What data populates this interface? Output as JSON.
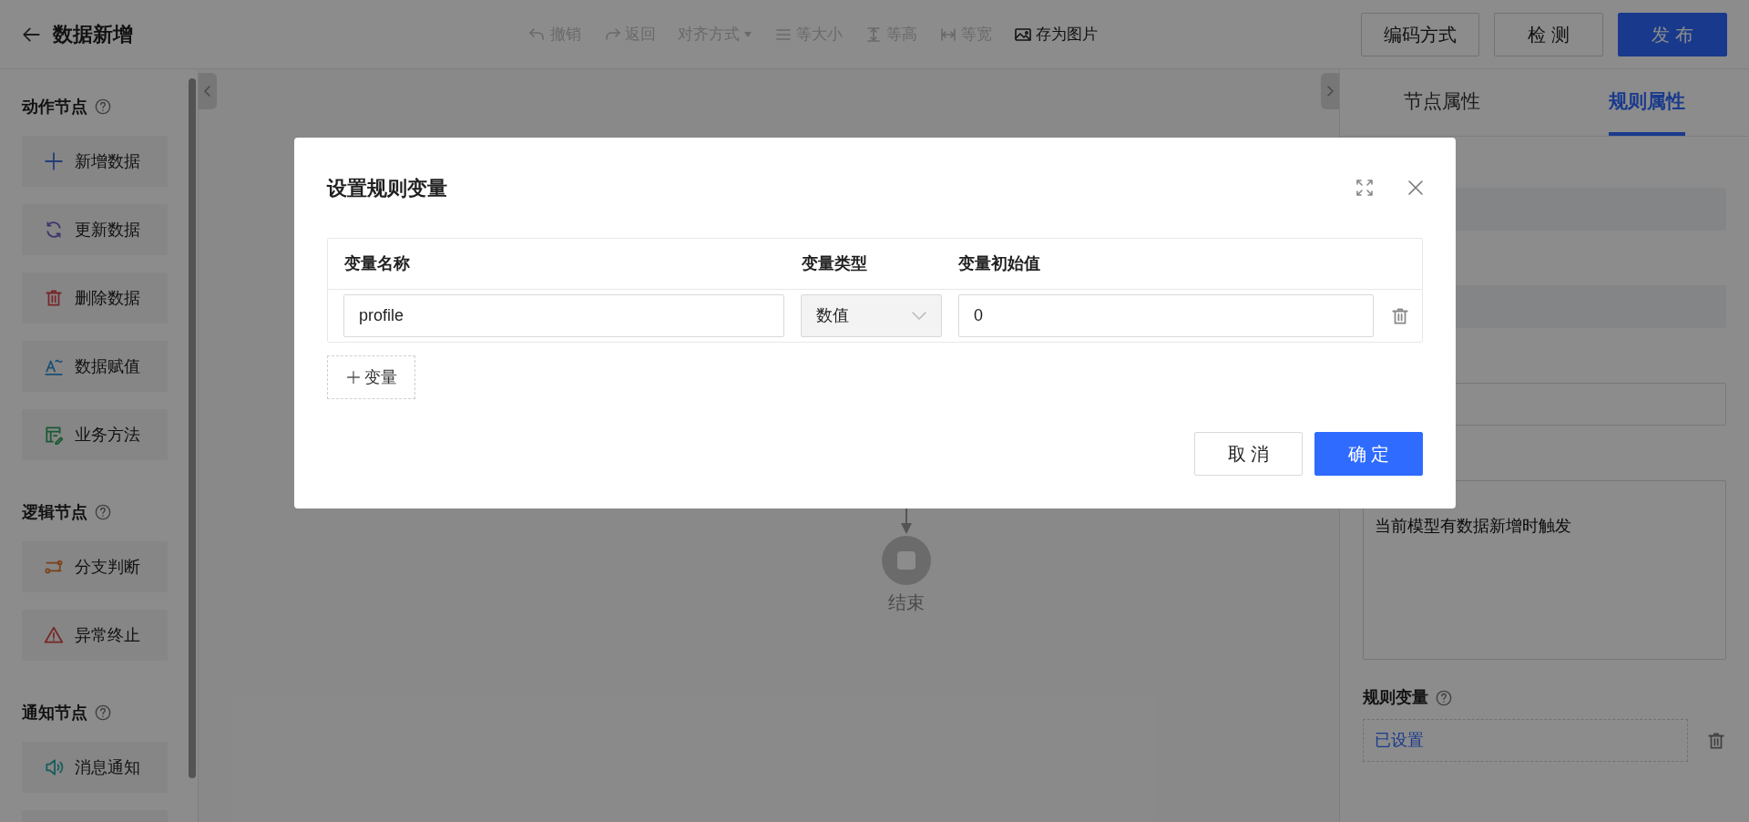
{
  "header": {
    "title": "数据新增",
    "toolbar": [
      {
        "label": "撤销",
        "kind": "undo",
        "disabled": true
      },
      {
        "label": "返回",
        "kind": "redo",
        "disabled": true
      },
      {
        "label": "对齐方式",
        "kind": "dropdown",
        "disabled": true
      },
      {
        "label": "等大小",
        "kind": "size",
        "disabled": true
      },
      {
        "label": "等高",
        "kind": "height",
        "disabled": true
      },
      {
        "label": "等宽",
        "kind": "width",
        "disabled": true
      },
      {
        "label": "存为图片",
        "kind": "image",
        "disabled": false
      }
    ],
    "actions": [
      {
        "label": "编码方式",
        "kind": "default"
      },
      {
        "label": "检 测",
        "kind": "default"
      },
      {
        "label": "发 布",
        "kind": "primary"
      }
    ]
  },
  "sidebar": {
    "sections": [
      {
        "title": "动作节点",
        "items": [
          {
            "label": "新增数据",
            "kind": "plus"
          },
          {
            "label": "更新数据",
            "kind": "refresh"
          },
          {
            "label": "删除数据",
            "kind": "trash"
          },
          {
            "label": "数据赋值",
            "kind": "assign"
          },
          {
            "label": "业务方法",
            "kind": "method"
          }
        ]
      },
      {
        "title": "逻辑节点",
        "items": [
          {
            "label": "分支判断",
            "kind": "branch"
          },
          {
            "label": "异常终止",
            "kind": "warning"
          }
        ]
      },
      {
        "title": "通知节点",
        "items": [
          {
            "label": "消息通知",
            "kind": "message"
          }
        ]
      }
    ]
  },
  "canvas": {
    "end_node": "结束"
  },
  "properties": {
    "tabs": [
      {
        "label": "节点属性",
        "selected": false
      },
      {
        "label": "规则属性",
        "selected": true
      }
    ],
    "description": "当前模型有数据新增时触发",
    "rule_variables": {
      "label": "规则变量",
      "value": "已设置"
    }
  },
  "dialog": {
    "title": "设置规则变量",
    "columns": [
      "变量名称",
      "变量类型",
      "变量初始值"
    ],
    "rows": [
      {
        "name": "profile",
        "type": "数值",
        "initial": "0"
      }
    ],
    "add_label": "变量",
    "buttons": [
      {
        "label": "取 消",
        "kind": "default"
      },
      {
        "label": "确 定",
        "kind": "primary"
      }
    ]
  }
}
